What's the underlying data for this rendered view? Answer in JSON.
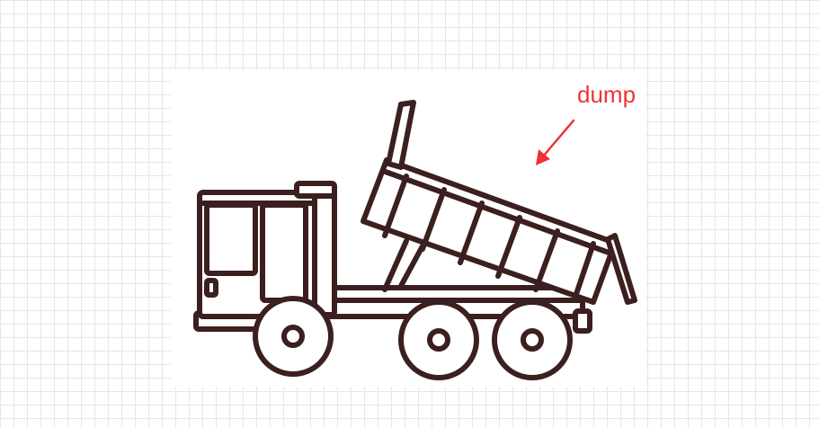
{
  "annotation": {
    "label": "dump",
    "color": "#ee3434"
  },
  "drawing": {
    "subject": "dump-truck",
    "stroke_color": "#3c1f1f"
  }
}
